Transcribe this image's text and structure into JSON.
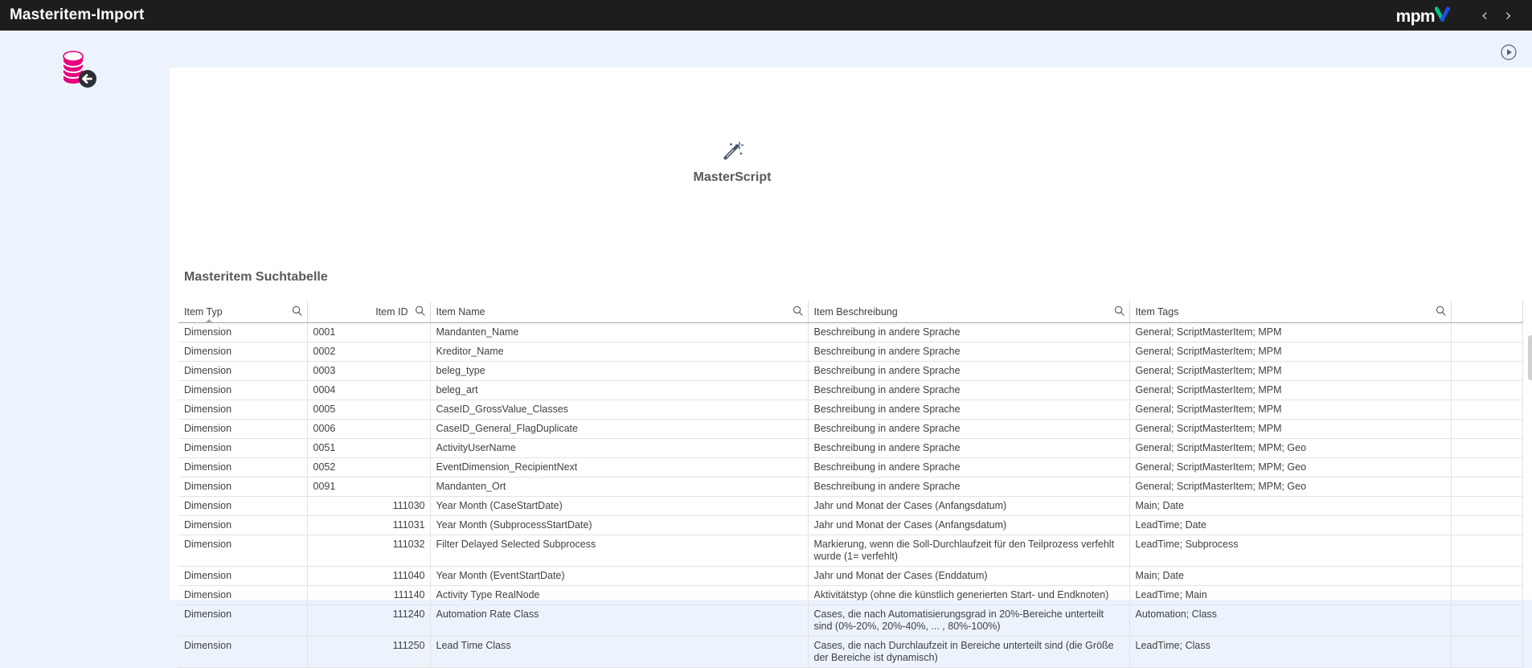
{
  "topbar": {
    "title": "Masteritem-Import",
    "logo_main": "mpm",
    "logo_x": "X",
    "prev_label": "‹",
    "next_label": "›",
    "logo_green": "#00c389",
    "logo_blue": "#1f4fe0"
  },
  "canvas": {
    "background": "#ecf3fd",
    "db_icon_name": "database-import-icon",
    "db_icon_color": "#e6007e",
    "play_icon_name": "play-circle-icon"
  },
  "masterscript": {
    "icon_name": "magic-wand-icon",
    "label": "MasterScript"
  },
  "table": {
    "title": "Masteritem Suchtabelle",
    "sorted_column": "Item Typ",
    "sort_direction": "ascending",
    "search_icon_name": "search-icon",
    "columns": [
      {
        "label": "Item Typ",
        "align": "left",
        "searchable": true
      },
      {
        "label": "Item ID",
        "align": "right",
        "searchable": true
      },
      {
        "label": "Item Name",
        "align": "left",
        "searchable": true
      },
      {
        "label": "Item Beschreibung",
        "align": "left",
        "searchable": true
      },
      {
        "label": "Item Tags",
        "align": "left",
        "searchable": true
      }
    ],
    "rows": [
      {
        "typ": "Dimension",
        "id": "0001",
        "id_align": "left",
        "name": "Mandanten_Name",
        "beschreibung": "Beschreibung in andere Sprache",
        "tags": "General; ScriptMasterItem; MPM"
      },
      {
        "typ": "Dimension",
        "id": "0002",
        "id_align": "left",
        "name": "Kreditor_Name",
        "beschreibung": "Beschreibung in andere Sprache",
        "tags": "General; ScriptMasterItem; MPM"
      },
      {
        "typ": "Dimension",
        "id": "0003",
        "id_align": "left",
        "name": "beleg_type",
        "beschreibung": "Beschreibung in andere Sprache",
        "tags": "General; ScriptMasterItem; MPM"
      },
      {
        "typ": "Dimension",
        "id": "0004",
        "id_align": "left",
        "name": "beleg_art",
        "beschreibung": "Beschreibung in andere Sprache",
        "tags": "General; ScriptMasterItem; MPM"
      },
      {
        "typ": "Dimension",
        "id": "0005",
        "id_align": "left",
        "name": "CaseID_GrossValue_Classes",
        "beschreibung": "Beschreibung in andere Sprache",
        "tags": "General; ScriptMasterItem; MPM"
      },
      {
        "typ": "Dimension",
        "id": "0006",
        "id_align": "left",
        "name": "CaseID_General_FlagDuplicate",
        "beschreibung": "Beschreibung in andere Sprache",
        "tags": "General; ScriptMasterItem; MPM"
      },
      {
        "typ": "Dimension",
        "id": "0051",
        "id_align": "left",
        "name": "ActivityUserName",
        "beschreibung": "Beschreibung in andere Sprache",
        "tags": "General; ScriptMasterItem; MPM; Geo"
      },
      {
        "typ": "Dimension",
        "id": "0052",
        "id_align": "left",
        "name": "EventDimension_RecipientNext",
        "beschreibung": "Beschreibung in andere Sprache",
        "tags": "General; ScriptMasterItem; MPM; Geo"
      },
      {
        "typ": "Dimension",
        "id": "0091",
        "id_align": "left",
        "name": "Mandanten_Ort",
        "beschreibung": "Beschreibung in andere Sprache",
        "tags": "General; ScriptMasterItem; MPM; Geo"
      },
      {
        "typ": "Dimension",
        "id": "111030",
        "id_align": "right",
        "name": "Year Month (CaseStartDate)",
        "beschreibung": "Jahr und Monat der Cases (Anfangsdatum)",
        "tags": "Main; Date"
      },
      {
        "typ": "Dimension",
        "id": "111031",
        "id_align": "right",
        "name": "Year Month (SubprocessStartDate)",
        "beschreibung": "Jahr und Monat der Cases (Anfangsdatum)",
        "tags": "LeadTime; Date"
      },
      {
        "typ": "Dimension",
        "id": "111032",
        "id_align": "right",
        "name": "Filter Delayed Selected Subprocess",
        "beschreibung": "Markierung, wenn die Soll-Durchlaufzeit für den Teilprozess verfehlt wurde (1= verfehlt)",
        "tags": "LeadTime; Subprocess"
      },
      {
        "typ": "Dimension",
        "id": "111040",
        "id_align": "right",
        "name": "Year Month (EventStartDate)",
        "beschreibung": "Jahr und Monat der Cases (Enddatum)",
        "tags": "Main; Date"
      },
      {
        "typ": "Dimension",
        "id": "111140",
        "id_align": "right",
        "name": "Activity Type RealNode",
        "beschreibung": "Aktivitätstyp (ohne die künstlich generierten Start- und Endknoten)",
        "tags": "LeadTime; Main"
      },
      {
        "typ": "Dimension",
        "id": "111240",
        "id_align": "right",
        "name": "Automation Rate Class",
        "beschreibung": "Cases, die nach Automatisierungsgrad in 20%-Bereiche unterteilt sind (0%-20%, 20%-40%, ... , 80%-100%)",
        "tags": "Automation; Class"
      },
      {
        "typ": "Dimension",
        "id": "111250",
        "id_align": "right",
        "name": "Lead Time Class",
        "beschreibung": "Cases, die nach Durchlaufzeit in Bereiche unterteilt sind (die Größe der Bereiche ist dynamisch)",
        "tags": "LeadTime; Class"
      }
    ]
  }
}
